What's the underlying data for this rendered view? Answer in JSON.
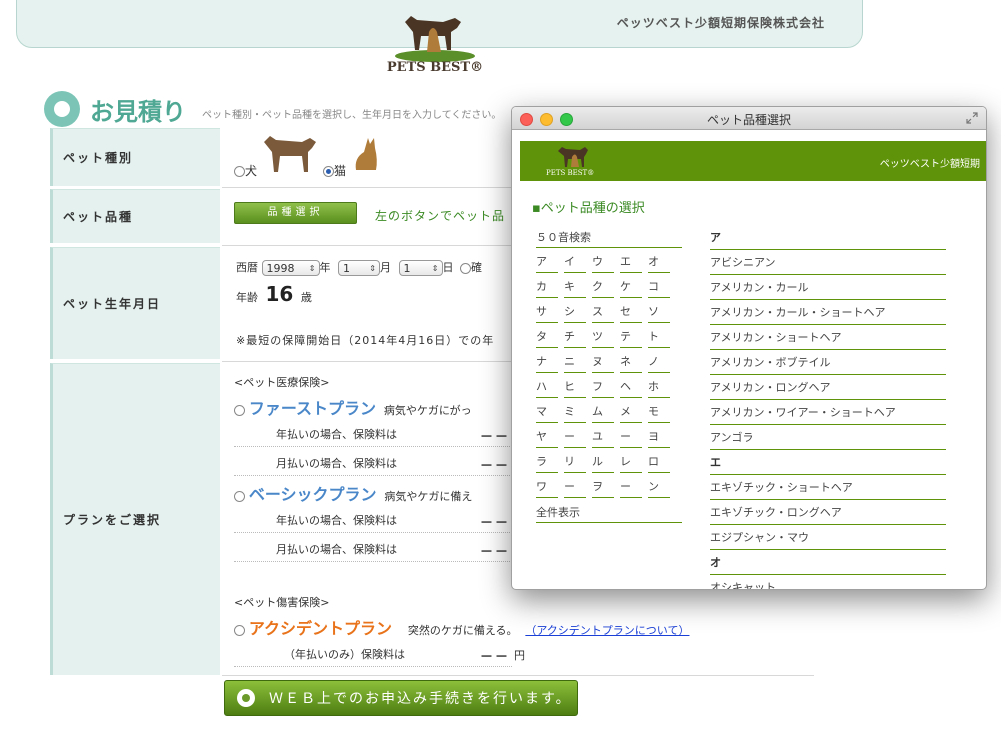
{
  "header": {
    "company": "ペッツベスト少額短期保険株式会社",
    "logo_text": "PETS BEST®"
  },
  "estimate": {
    "title": "お見積り",
    "description": "ペット種別・ペット品種を選択し、生年月日を入力してください。",
    "labels": {
      "pet_type": "ペット種別",
      "breed": "ペット品種",
      "birth": "ペット生年月日",
      "plan": "プランをご選択"
    },
    "pet_type": {
      "dog": "犬",
      "cat": "猫",
      "selected": "cat"
    },
    "breed_button": "品種選択",
    "breed_hint": "左のボタンでペット品",
    "birth": {
      "era": "西暦",
      "year": "1998",
      "year_unit": "年",
      "month": "1",
      "month_unit": "月",
      "day": "1",
      "day_unit": "日",
      "confirm": "確",
      "age_label": "年齢",
      "age_value": "16",
      "age_unit": "歳"
    },
    "note": "※最短の保障開始日（2014年4月16日）での年",
    "medical_heading": "<ペット医療保険>",
    "plans": [
      {
        "name": "ファーストプラン",
        "desc": "病気やケガにがっ",
        "annual": "年払いの場合、保険料は",
        "monthly": "月払いの場合、保険料は",
        "dash": "－－"
      },
      {
        "name": "ベーシックプラン",
        "desc": "病気やケガに備え",
        "annual": "年払いの場合、保険料は",
        "monthly": "月払いの場合、保険料は",
        "dash": "－－"
      }
    ],
    "injury_heading": "<ペット傷害保険>",
    "accident": {
      "name": "アクシデントプラン",
      "desc": "突然のケガに備える。",
      "link": "（アクシデントプランについて）",
      "annual_only": "（年払いのみ）保険料は",
      "dash": "－－",
      "unit": "円"
    },
    "apply_button": "ＷＥＢ上でのお申込み手続きを行います。"
  },
  "modal": {
    "title": "ペット品種選択",
    "company": "ペッツベスト少額短期",
    "logo_text": "PETS BEST®",
    "section_title": "▪ペット品種の選択",
    "kana_heading": "５０音検索",
    "kana_rows": [
      [
        "ア",
        "イ",
        "ウ",
        "エ",
        "オ"
      ],
      [
        "カ",
        "キ",
        "ク",
        "ケ",
        "コ"
      ],
      [
        "サ",
        "シ",
        "ス",
        "セ",
        "ソ"
      ],
      [
        "タ",
        "チ",
        "ツ",
        "テ",
        "ト"
      ],
      [
        "ナ",
        "ニ",
        "ヌ",
        "ネ",
        "ノ"
      ],
      [
        "ハ",
        "ヒ",
        "フ",
        "ヘ",
        "ホ"
      ],
      [
        "マ",
        "ミ",
        "ム",
        "メ",
        "モ"
      ],
      [
        "ヤ",
        "ー",
        "ユ",
        "ー",
        "ヨ"
      ],
      [
        "ラ",
        "リ",
        "ル",
        "レ",
        "ロ"
      ],
      [
        "ワ",
        "ー",
        "ヲ",
        "ー",
        "ン"
      ]
    ],
    "show_all": "全件表示",
    "breeds": [
      {
        "text": "ア",
        "head": true
      },
      {
        "text": "アビシニアン"
      },
      {
        "text": "アメリカン・カール"
      },
      {
        "text": "アメリカン・カール・ショートヘア"
      },
      {
        "text": "アメリカン・ショートヘア"
      },
      {
        "text": "アメリカン・ボブテイル"
      },
      {
        "text": "アメリカン・ロングヘア"
      },
      {
        "text": "アメリカン・ワイアー・ショートヘア"
      },
      {
        "text": "アンゴラ"
      },
      {
        "text": "エ",
        "head": true
      },
      {
        "text": "エキゾチック・ショートヘア"
      },
      {
        "text": "エキゾチック・ロングヘア"
      },
      {
        "text": "エジプシャン・マウ"
      },
      {
        "text": "オ",
        "head": true
      },
      {
        "text": "オシキャット"
      }
    ]
  },
  "colors": {
    "teal": "#4fa893",
    "green": "#5f930a",
    "plan_blue": "#4a87c9",
    "accident_orange": "#e8731a"
  }
}
